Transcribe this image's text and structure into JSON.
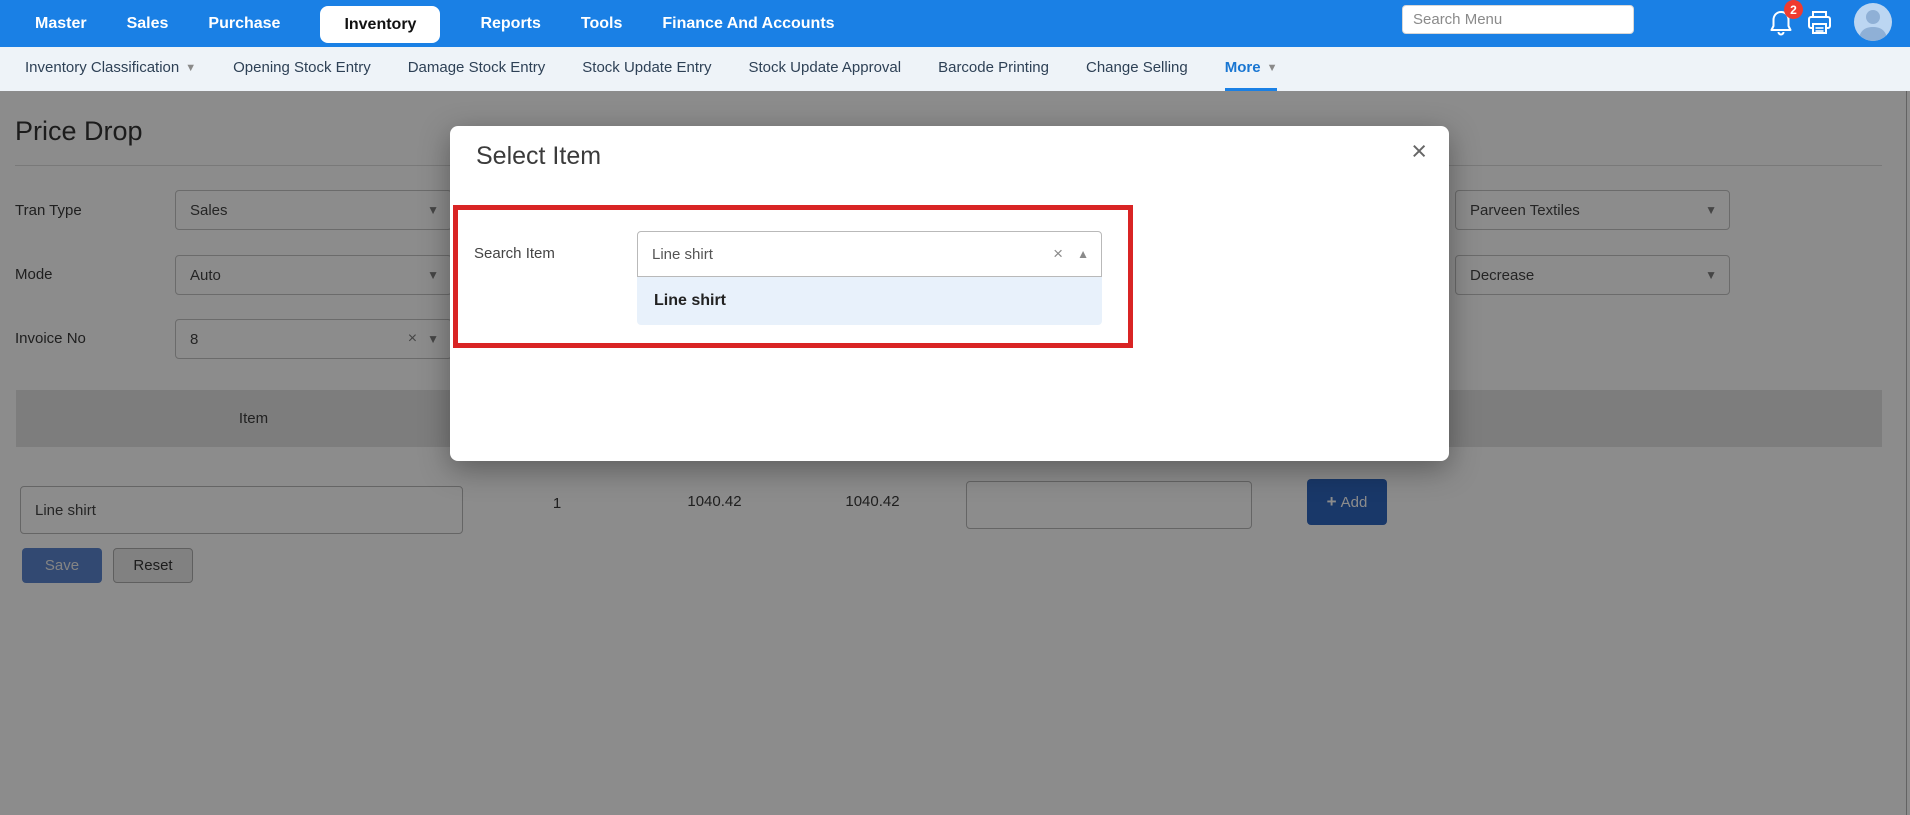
{
  "topnav": {
    "items": [
      "Master",
      "Sales",
      "Purchase",
      "Inventory",
      "Reports",
      "Tools",
      "Finance And Accounts"
    ],
    "active_item": "Inventory",
    "search_placeholder": "Search Menu",
    "notification_count": "2"
  },
  "subnav": {
    "items": [
      "Inventory Classification",
      "Opening Stock Entry",
      "Damage Stock Entry",
      "Stock Update Entry",
      "Stock Update Approval",
      "Barcode Printing",
      "Change Selling",
      "More"
    ],
    "active_item": "More"
  },
  "page": {
    "title": "Price Drop",
    "form": {
      "tran_type": {
        "label": "Tran Type",
        "value": "Sales"
      },
      "mode": {
        "label": "Mode",
        "value": "Auto"
      },
      "invoice_no": {
        "label": "Invoice No",
        "value": "8"
      },
      "company": {
        "value": "Parveen Textiles"
      },
      "direction": {
        "value": "Decrease"
      }
    },
    "table": {
      "header_item": "Item",
      "row": {
        "item": "Line shirt",
        "qty": "1",
        "price1": "1040.42",
        "price2": "1040.42",
        "new_price": ""
      }
    },
    "actions": {
      "add": "Add",
      "save": "Save",
      "reset": "Reset"
    }
  },
  "modal": {
    "title": "Select Item",
    "search_label": "Search Item",
    "search_value": "Line shirt",
    "option": "Line shirt"
  },
  "icons": {
    "caret_down": "▼",
    "caret_up": "▲",
    "clear": "×",
    "close": "×",
    "plus": "+"
  },
  "colors": {
    "nav_blue": "#1a80e5",
    "link_blue": "#1976d2",
    "badge_red": "#f03b30",
    "annotation_red": "#d92424",
    "primary_button": "#2e66c0",
    "option_highlight": "#e8f1fb"
  }
}
